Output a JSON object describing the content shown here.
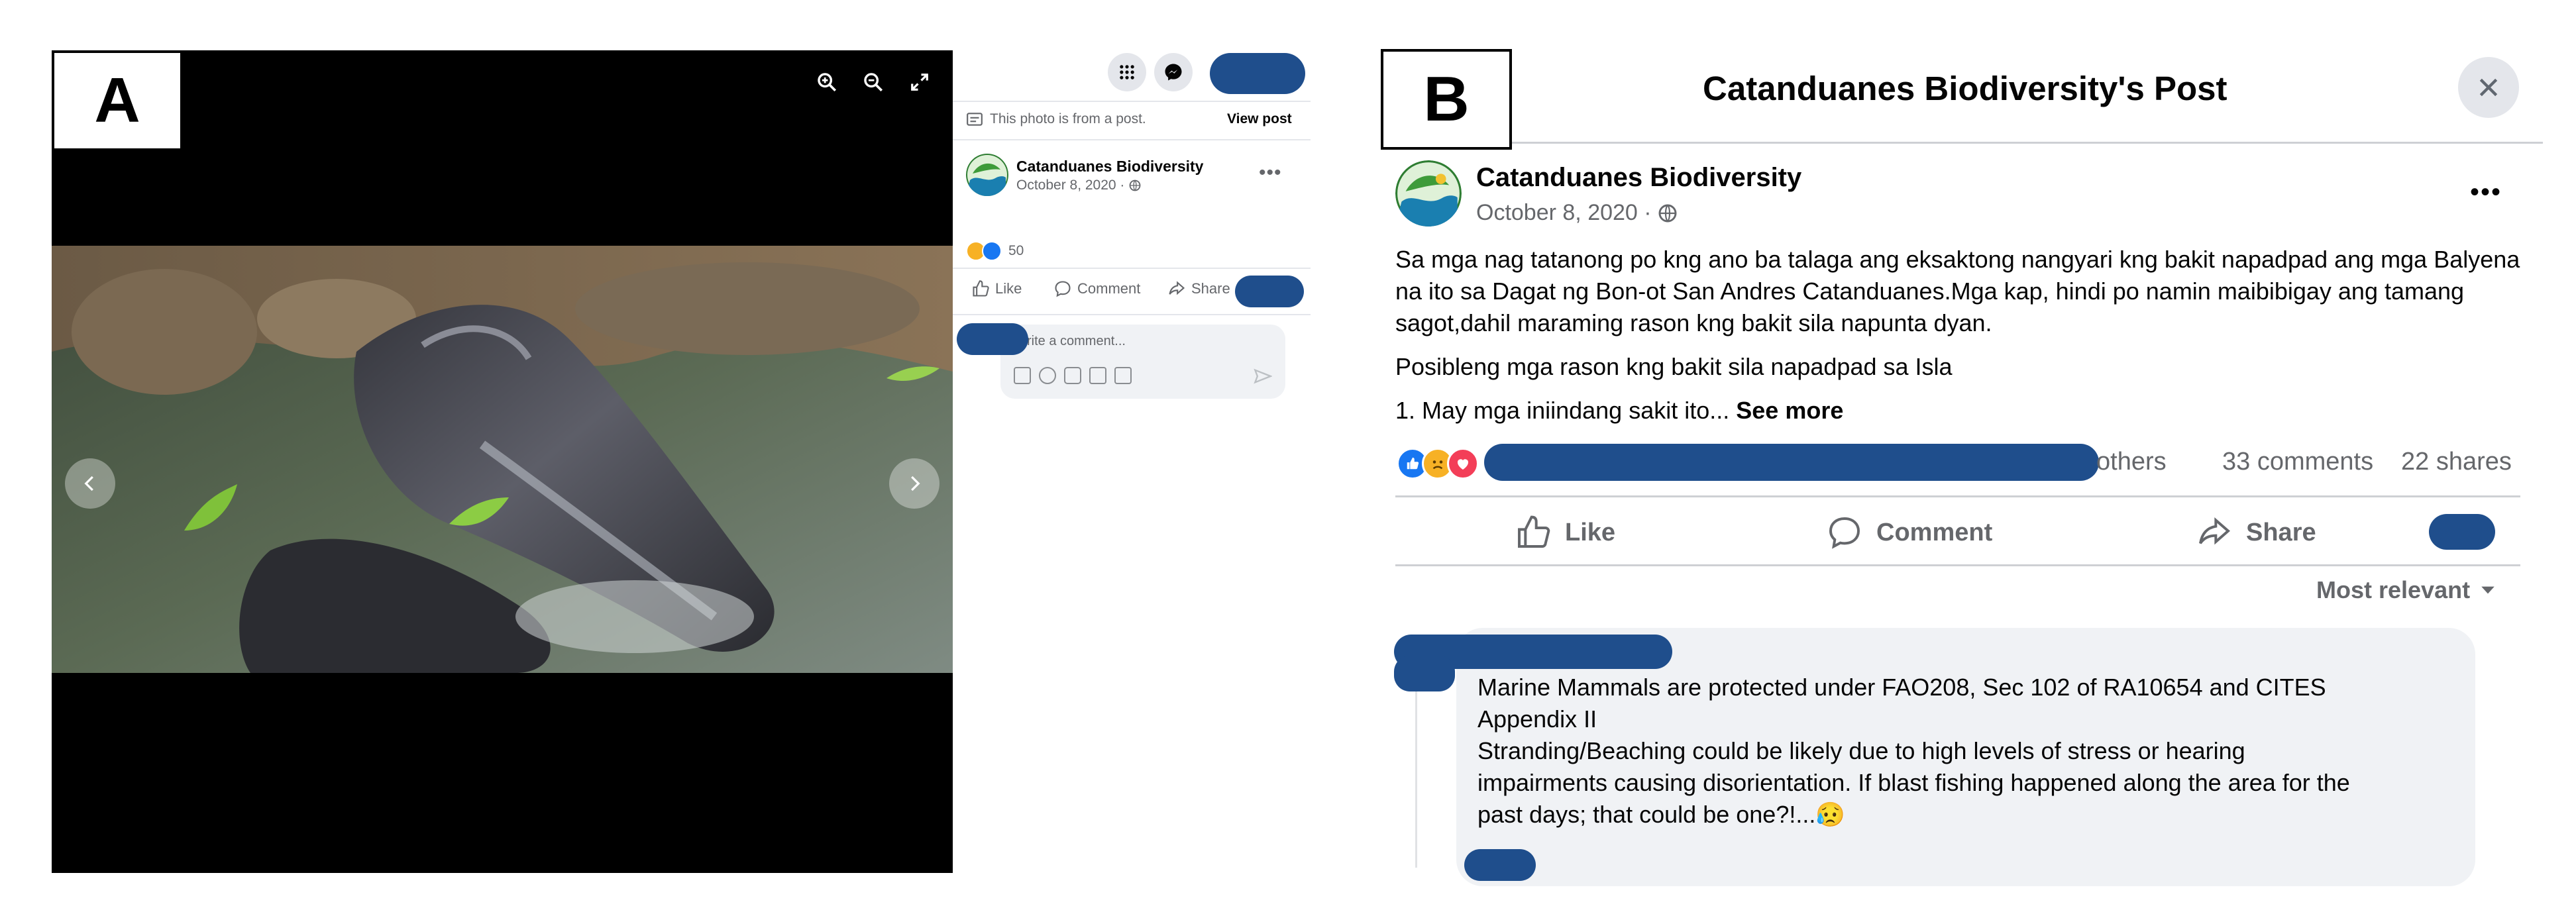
{
  "labels": {
    "a": "A",
    "b": "B"
  },
  "panel_a": {
    "photo_notice": "This photo is from a post.",
    "view_post": "View post",
    "page_name": "Catanduanes Biodiversity",
    "date": "October 8, 2020 ·",
    "reaction_count": "50",
    "like": "Like",
    "comment": "Comment",
    "share": "Share",
    "write_comment": "rite a comment..."
  },
  "panel_b": {
    "title": "Catanduanes Biodiversity's Post",
    "page_name": "Catanduanes Biodiversity",
    "date": "October 8, 2020 ·",
    "paragraph1": "Sa mga nag tatanong po kng ano ba talaga ang eksaktong nangyari kng bakit napadpad ang mga Balyena na ito sa Dagat ng Bon-ot San Andres Catanduanes.Mga kap, hindi po namin maibibigay ang tamang sagot,dahil maraming rason kng bakit sila napunta dyan.",
    "paragraph2": "Posibleng mga rason kng bakit sila napadpad sa Isla",
    "paragraph3": "1. May mga iniindang sakit ito...",
    "see_more": "See more",
    "others": "others",
    "comments_count": "33 comments",
    "shares_count": "22 shares",
    "like": "Like",
    "comment": "Comment",
    "share": "Share",
    "sort": "Most relevant",
    "comment_line1": "Marine Mammals are protected under FAO208, Sec 102 of RA10654 and CITES",
    "comment_line2": "Appendix II",
    "comment_line3": "Stranding/Beaching could be likely due to high levels of stress or hearing",
    "comment_line4": "impairments causing disorientation. If blast fishing happened along the area for the",
    "comment_line5": "past days; that could be one?!...",
    "comment_emoji": "😥"
  },
  "colors": {
    "redaction": "#1f4e8c",
    "like_blue": "#1877f2",
    "love_red": "#f33e58",
    "sad_yellow": "#f7b125"
  }
}
